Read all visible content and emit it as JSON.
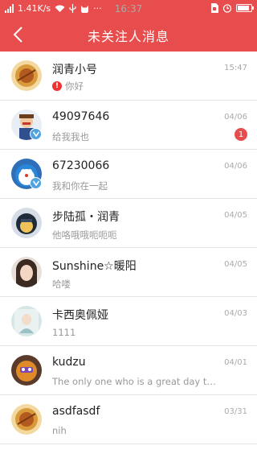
{
  "status_bar": {
    "carrier_speed": "1.41K/s",
    "time": "16:37",
    "icons": [
      "signal-icon",
      "wifi-icon",
      "usb-icon",
      "cat-icon",
      "more-icon",
      "sim-icon",
      "alarm-icon",
      "battery-icon"
    ],
    "battery_level": 0.85
  },
  "header": {
    "title": "未关注人消息",
    "back_icon": "chevron-left-icon"
  },
  "colors": {
    "accent": "#e84d4d",
    "verified": "#4fa3e0"
  },
  "conversations": [
    {
      "name": "润青小号",
      "message": "你好",
      "time": "15:47",
      "has_warning": true,
      "verified": false,
      "unread": ""
    },
    {
      "name": "49097646",
      "message": "给我我也",
      "time": "04/06",
      "has_warning": false,
      "verified": true,
      "unread": "1"
    },
    {
      "name": "67230066",
      "message": "我和你在一起",
      "time": "04/06",
      "has_warning": false,
      "verified": true,
      "unread": ""
    },
    {
      "name": "步陆孤・润青",
      "message": "他咯哦哦呃呃呃",
      "time": "04/05",
      "has_warning": false,
      "verified": false,
      "unread": ""
    },
    {
      "name": "Sunshine☆暖阳",
      "message": "哈喽",
      "time": "04/05",
      "has_warning": false,
      "verified": false,
      "unread": ""
    },
    {
      "name": "卡西奥佩娅",
      "message": "1111",
      "time": "04/03",
      "has_warning": false,
      "verified": false,
      "unread": ""
    },
    {
      "name": "kudzu",
      "message": "The only one who is a great day to be...",
      "time": "04/01",
      "has_warning": false,
      "verified": false,
      "unread": ""
    },
    {
      "name": "asdfasdf",
      "message": "nih",
      "time": "03/31",
      "has_warning": false,
      "verified": false,
      "unread": ""
    }
  ]
}
